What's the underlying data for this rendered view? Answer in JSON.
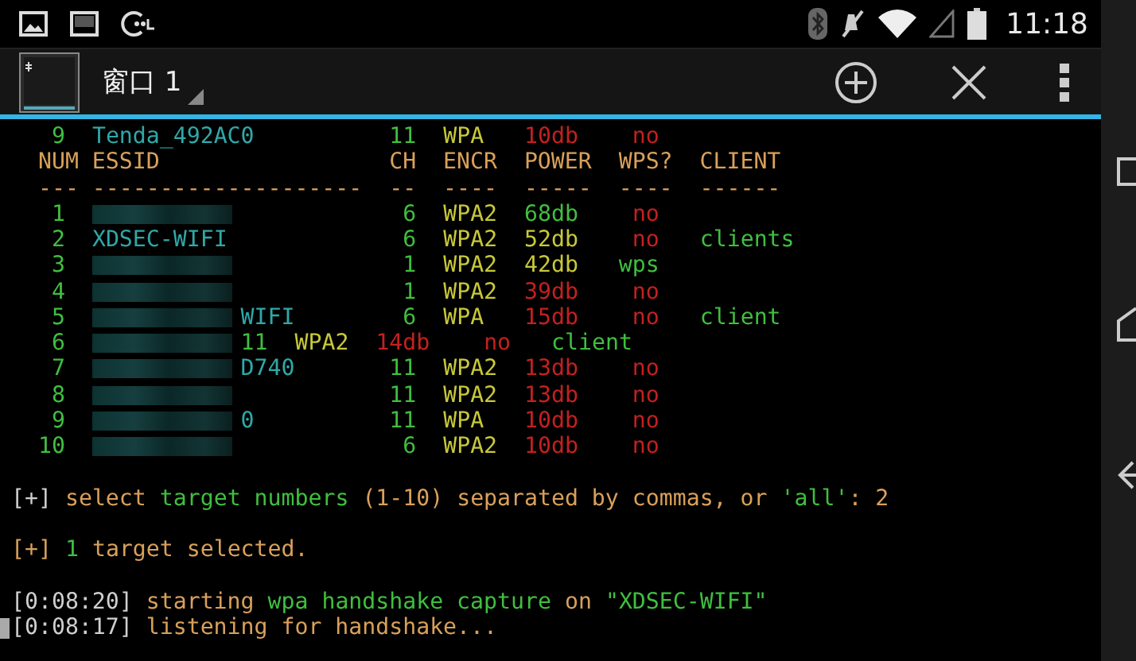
{
  "status_bar": {
    "time": "11:18"
  },
  "action_bar": {
    "title": "窗口 1"
  },
  "terminal": {
    "lines": [
      {
        "kind": "text",
        "redacted": false,
        "cursor": false,
        "segments": [
          {
            "text": "   9  ",
            "color": "#3fbf3f"
          },
          {
            "text": "Tenda_492AC0",
            "color": "#2fa8a8"
          },
          {
            "text": "          11  ",
            "color": "#3fbf3f"
          },
          {
            "text": "WPA   ",
            "color": "#c8c83a"
          },
          {
            "text": "10db    no",
            "color": "#c42020"
          }
        ]
      },
      {
        "kind": "text",
        "redacted": false,
        "cursor": false,
        "segments": [
          {
            "text": "  NUM ESSID                 CH  ENCR  POWER  WPS?  CLIENT",
            "color": "#d9a05a"
          }
        ]
      },
      {
        "kind": "text",
        "redacted": false,
        "cursor": false,
        "segments": [
          {
            "text": "  --- --------------------  --  ----  -----  ----  ------",
            "color": "#d9a05a"
          }
        ]
      },
      {
        "kind": "text",
        "redacted": true,
        "cursor": false,
        "segments": [
          {
            "text": "   1",
            "color": "#3fbf3f"
          },
          {
            "text": "                         6  ",
            "color": "#3fbf3f"
          },
          {
            "text": "WPA2  ",
            "color": "#c8c83a"
          },
          {
            "text": "68db",
            "color": "#3fbf3f"
          },
          {
            "text": "    no",
            "color": "#c42020"
          }
        ]
      },
      {
        "kind": "text",
        "redacted": false,
        "cursor": false,
        "segments": [
          {
            "text": "   2  ",
            "color": "#3fbf3f"
          },
          {
            "text": "XDSEC-WIFI",
            "color": "#2fa8a8"
          },
          {
            "text": "             6  ",
            "color": "#3fbf3f"
          },
          {
            "text": "WPA2  52db",
            "color": "#c8c83a"
          },
          {
            "text": "    no",
            "color": "#c42020"
          },
          {
            "text": "   clients",
            "color": "#3fbf3f"
          }
        ]
      },
      {
        "kind": "text",
        "redacted": true,
        "cursor": false,
        "segments": [
          {
            "text": "   3",
            "color": "#3fbf3f"
          },
          {
            "text": "                         1  ",
            "color": "#3fbf3f"
          },
          {
            "text": "WPA2  42db",
            "color": "#c8c83a"
          },
          {
            "text": "   wps",
            "color": "#3fbf3f"
          }
        ]
      },
      {
        "kind": "text",
        "redacted": true,
        "cursor": false,
        "segments": [
          {
            "text": "   4",
            "color": "#3fbf3f"
          },
          {
            "text": "                         1  ",
            "color": "#3fbf3f"
          },
          {
            "text": "WPA2  ",
            "color": "#c8c83a"
          },
          {
            "text": "39db    no",
            "color": "#c42020"
          }
        ]
      },
      {
        "kind": "text",
        "redacted": true,
        "cursor": false,
        "segments": [
          {
            "text": "   5",
            "color": "#3fbf3f"
          },
          {
            "text": "             WIFI",
            "color": "#2fa8a8"
          },
          {
            "text": "        6  ",
            "color": "#3fbf3f"
          },
          {
            "text": "WPA   ",
            "color": "#c8c83a"
          },
          {
            "text": "15db    no",
            "color": "#c42020"
          },
          {
            "text": "   client",
            "color": "#3fbf3f"
          }
        ]
      },
      {
        "kind": "text",
        "redacted": true,
        "cursor": false,
        "segments": [
          {
            "text": "   6",
            "color": "#3fbf3f"
          },
          {
            "text": "             11  ",
            "color": "#3fbf3f"
          },
          {
            "text": "WPA2  ",
            "color": "#c8c83a"
          },
          {
            "text": "14db    no",
            "color": "#c42020"
          },
          {
            "text": "   client",
            "color": "#3fbf3f"
          }
        ]
      },
      {
        "kind": "text",
        "redacted": true,
        "cursor": false,
        "segments": [
          {
            "text": "   7",
            "color": "#3fbf3f"
          },
          {
            "text": "             D740",
            "color": "#2fa8a8"
          },
          {
            "text": "       11  ",
            "color": "#3fbf3f"
          },
          {
            "text": "WPA2  ",
            "color": "#c8c83a"
          },
          {
            "text": "13db    no",
            "color": "#c42020"
          }
        ]
      },
      {
        "kind": "text",
        "redacted": true,
        "cursor": false,
        "segments": [
          {
            "text": "   8",
            "color": "#3fbf3f"
          },
          {
            "text": "                        11  ",
            "color": "#3fbf3f"
          },
          {
            "text": "WPA2  ",
            "color": "#c8c83a"
          },
          {
            "text": "13db    no",
            "color": "#c42020"
          }
        ]
      },
      {
        "kind": "text",
        "redacted": true,
        "cursor": false,
        "segments": [
          {
            "text": "   9",
            "color": "#3fbf3f"
          },
          {
            "text": "             0",
            "color": "#2fa8a8"
          },
          {
            "text": "          11  ",
            "color": "#3fbf3f"
          },
          {
            "text": "WPA   ",
            "color": "#c8c83a"
          },
          {
            "text": "10db    no",
            "color": "#c42020"
          }
        ]
      },
      {
        "kind": "text",
        "redacted": true,
        "cursor": false,
        "segments": [
          {
            "text": "  10",
            "color": "#3fbf3f"
          },
          {
            "text": "                         6  ",
            "color": "#3fbf3f"
          },
          {
            "text": "WPA2  ",
            "color": "#c8c83a"
          },
          {
            "text": "10db    no",
            "color": "#c42020"
          }
        ]
      },
      {
        "kind": "blank"
      },
      {
        "kind": "text",
        "redacted": false,
        "cursor": false,
        "segments": [
          {
            "text": "[+]",
            "color": "#cfcfcf"
          },
          {
            "text": " select ",
            "color": "#d9a05a"
          },
          {
            "text": "target numbers",
            "color": "#3fbf3f"
          },
          {
            "text": " (1-10) separated by commas, or ",
            "color": "#d9a05a"
          },
          {
            "text": "'all'",
            "color": "#3fbf3f"
          },
          {
            "text": ": 2",
            "color": "#d9a05a"
          }
        ]
      },
      {
        "kind": "blank"
      },
      {
        "kind": "text",
        "redacted": false,
        "cursor": false,
        "segments": [
          {
            "text": "[+]",
            "color": "#d9a05a"
          },
          {
            "text": " 1",
            "color": "#3fbf3f"
          },
          {
            "text": " target selected.",
            "color": "#d9a05a"
          }
        ]
      },
      {
        "kind": "blank"
      },
      {
        "kind": "text",
        "redacted": false,
        "cursor": false,
        "segments": [
          {
            "text": "[0:08:20]",
            "color": "#cfcfcf"
          },
          {
            "text": " starting ",
            "color": "#d9a05a"
          },
          {
            "text": "wpa handshake capture",
            "color": "#3fbf3f"
          },
          {
            "text": " on ",
            "color": "#d9a05a"
          },
          {
            "text": "\"XDSEC-WIFI\"",
            "color": "#3fbf3f"
          }
        ]
      },
      {
        "kind": "text",
        "redacted": false,
        "cursor": true,
        "segments": [
          {
            "text": "[0:08:17]",
            "color": "#cfcfcf"
          },
          {
            "text": " listening for handshake...",
            "color": "#d9a05a"
          }
        ]
      }
    ]
  }
}
